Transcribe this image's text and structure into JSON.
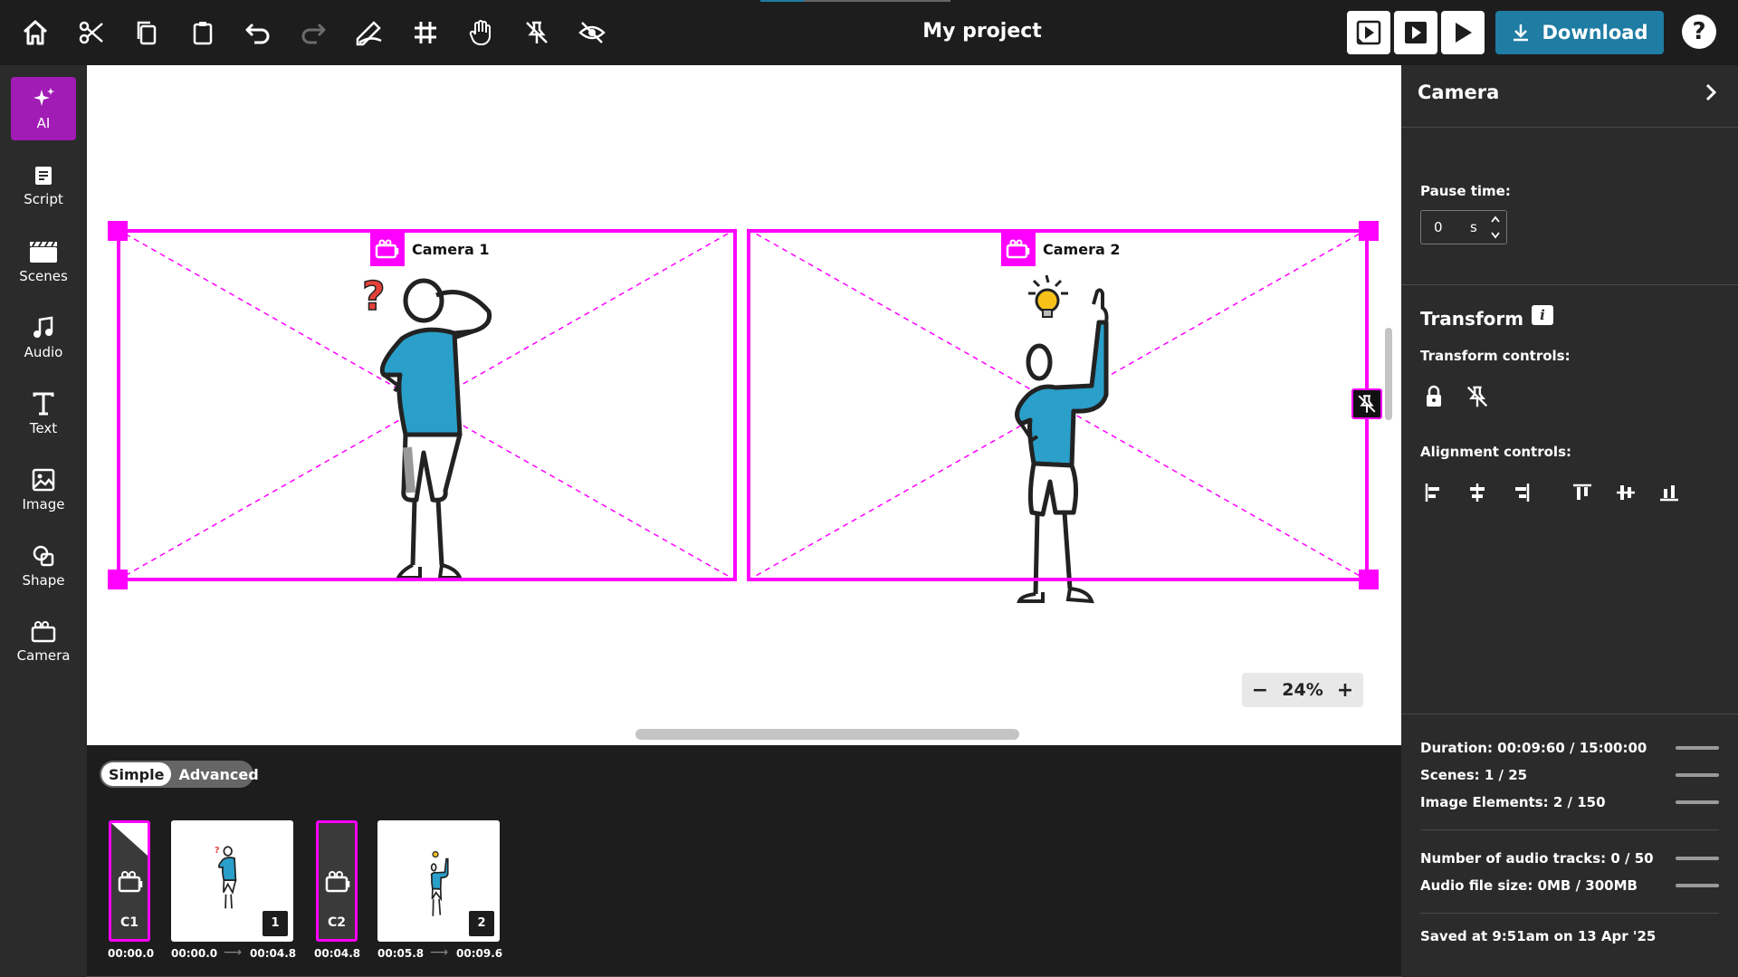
{
  "app": {
    "project_title": "My project"
  },
  "toolbar": {
    "icons": [
      "home-icon",
      "cut-icon",
      "copy-icon",
      "paste-icon",
      "undo-icon",
      "redo-icon",
      "draw-icon",
      "grid-icon",
      "hand-icon",
      "unpin-icon",
      "hide-icon"
    ],
    "download_label": "Download",
    "help_label": "?"
  },
  "sidebar": {
    "items": [
      {
        "label": "AI",
        "icon": "sparkle-icon",
        "active": true
      },
      {
        "label": "Script",
        "icon": "script-icon"
      },
      {
        "label": "Scenes",
        "icon": "clapperboard-icon"
      },
      {
        "label": "Audio",
        "icon": "music-icon"
      },
      {
        "label": "Text",
        "icon": "text-icon"
      },
      {
        "label": "Image",
        "icon": "image-icon"
      },
      {
        "label": "Shape",
        "icon": "shape-icon"
      },
      {
        "label": "Camera",
        "icon": "camera-icon"
      }
    ]
  },
  "canvas": {
    "cameras": [
      {
        "label": "Camera 1"
      },
      {
        "label": "Camera 2"
      }
    ],
    "zoom": "24%",
    "zoom_out": "−",
    "zoom_in": "+"
  },
  "panel": {
    "title": "Camera",
    "pause_label": "Pause time:",
    "pause_value": "0",
    "pause_unit": "s",
    "transform_title": "Transform",
    "info_label": "i",
    "transform_controls_label": "Transform controls:",
    "alignment_controls_label": "Alignment controls:",
    "stats": {
      "duration": "Duration: 00:09:60 / 15:00:00",
      "scenes": "Scenes: 1 / 25",
      "image_elements": "Image Elements: 2 / 150",
      "audio_tracks": "Number of audio tracks: 0 / 50",
      "audio_size": "Audio file size: 0MB / 300MB",
      "saved": "Saved at 9:51am on 13 Apr '25"
    }
  },
  "timeline": {
    "mode_simple": "Simple",
    "mode_advanced": "Advanced",
    "clips": [
      {
        "id": "C1",
        "start": "00:00.0"
      },
      {
        "number": "1",
        "start": "00:00.0",
        "end": "00:04.8"
      },
      {
        "id": "C2",
        "start": "00:04.8"
      },
      {
        "number": "2",
        "start": "00:05.8",
        "end": "00:09.6"
      }
    ]
  },
  "colors": {
    "accent_magenta": "#ff00ff",
    "download_blue": "#1f7ca3",
    "ai_purple": "#a11bb5",
    "figure_shirt": "#2a9fc9"
  }
}
